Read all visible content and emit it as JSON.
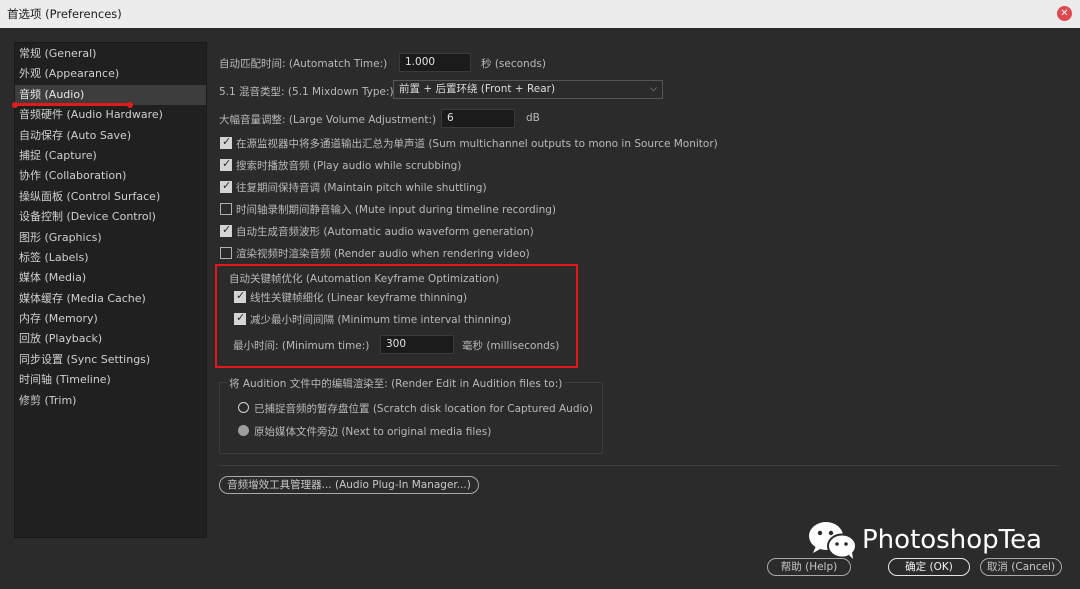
{
  "window": {
    "title": "首选项 (Preferences)"
  },
  "sidebar": {
    "items": [
      {
        "label": "常规 (General)"
      },
      {
        "label": "外观 (Appearance)"
      },
      {
        "label": "音频 (Audio)"
      },
      {
        "label": "音频硬件 (Audio Hardware)"
      },
      {
        "label": "自动保存 (Auto Save)"
      },
      {
        "label": "捕捉 (Capture)"
      },
      {
        "label": "协作 (Collaboration)"
      },
      {
        "label": "操纵面板 (Control Surface)"
      },
      {
        "label": "设备控制 (Device Control)"
      },
      {
        "label": "图形 (Graphics)"
      },
      {
        "label": "标签 (Labels)"
      },
      {
        "label": "媒体 (Media)"
      },
      {
        "label": "媒体缓存 (Media Cache)"
      },
      {
        "label": "内存 (Memory)"
      },
      {
        "label": "回放 (Playback)"
      },
      {
        "label": "同步设置 (Sync Settings)"
      },
      {
        "label": "时间轴 (Timeline)"
      },
      {
        "label": "修剪 (Trim)"
      }
    ],
    "selected_index": 2
  },
  "audio": {
    "automatch": {
      "label": "自动匹配时间: (Automatch Time:)",
      "value": "1.000",
      "unit": "秒 (seconds)"
    },
    "mixdown": {
      "label": "5.1 混音类型: (5.1 Mixdown Type:)",
      "value": "前置 + 后置环绕 (Front + Rear)"
    },
    "large_volume": {
      "label": "大幅音量调整: (Large Volume Adjustment:)",
      "value": "6",
      "unit": "dB"
    },
    "checkboxes": [
      {
        "label": "在源监视器中将多通道输出汇总为单声道 (Sum multichannel outputs to mono in Source Monitor)",
        "checked": true
      },
      {
        "label": "搜索时播放音频 (Play audio while scrubbing)",
        "checked": true
      },
      {
        "label": "往复期间保持音调 (Maintain pitch while shuttling)",
        "checked": true
      },
      {
        "label": "时间轴录制期间静音输入 (Mute input during timeline recording)",
        "checked": false
      },
      {
        "label": "自动生成音频波形 (Automatic audio waveform generation)",
        "checked": true
      },
      {
        "label": "渲染视频时渲染音频 (Render audio when rendering video)",
        "checked": false
      }
    ],
    "keyframe_opt": {
      "heading": "自动关键帧优化 (Automation Keyframe Optimization)",
      "linear": {
        "label": "线性关键帧细化 (Linear keyframe thinning)",
        "checked": true
      },
      "min_interval": {
        "label": "减少最小时间间隔 (Minimum time interval thinning)",
        "checked": true
      },
      "min_time": {
        "label": "最小时间: (Minimum time:)",
        "value": "300",
        "unit": "毫秒 (milliseconds)"
      }
    },
    "render_edit": {
      "legend": "将 Audition 文件中的编辑渲染至: (Render Edit in Audition files to:)",
      "options": [
        {
          "label": "已捕捉音频的暂存盘位置 (Scratch disk location for Captured Audio)",
          "selected": false
        },
        {
          "label": "原始媒体文件旁边 (Next to original media files)",
          "selected": true
        }
      ]
    },
    "plugin_manager_label": "音频增效工具管理器... (Audio Plug-In Manager...)"
  },
  "footer": {
    "help_label": "帮助 (Help)",
    "ok_label": "确定 (OK)",
    "cancel_label": "取消 (Cancel)"
  },
  "watermark": {
    "text": "PhotoshopTea"
  },
  "colors": {
    "highlight_red": "#e4171b",
    "bg": "#2b2b2b",
    "sidebar_bg": "#202020"
  }
}
